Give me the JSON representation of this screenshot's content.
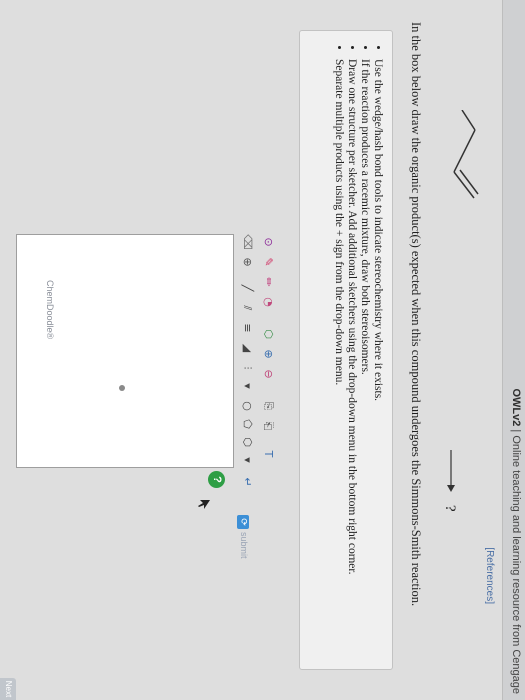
{
  "header": {
    "brand": "OWLv2",
    "brand_tagline": "| Online teaching and learning resource from Cengage"
  },
  "reference_link": "[References]",
  "question": {
    "text": "In the box below draw the organic product(s) expected when this compound undergoes the Simmons-Smith reaction.",
    "arrow": "→",
    "unknown_product": "?"
  },
  "instructions": [
    "Use the wedge/hash bond tools to indicate stereochemistry where it exists.",
    "If the reaction produces a racemic mixture, draw both stereoisomers.",
    "Draw one structure per sketcher. Add additional sketchers using the drop-down menu in the bottom right corner.",
    "Separate multiple products using the + sign from the drop-down menu."
  ],
  "toolbar": {
    "row1": [
      {
        "name": "lasso-tool-icon",
        "glyph": "⊙"
      },
      {
        "name": "eraser-tool-icon",
        "glyph": "✎"
      },
      {
        "name": "pencil-tool-icon",
        "glyph": "✏"
      },
      {
        "name": "ring-tool-icon",
        "glyph": "◔"
      },
      {
        "name": "template-tool-icon",
        "glyph": "⬡"
      },
      {
        "name": "charge-plus-icon",
        "glyph": "⊕"
      },
      {
        "name": "charge-minus-icon",
        "glyph": "⊖"
      },
      {
        "name": "copy-tool-icon",
        "glyph": "⎘"
      },
      {
        "name": "paste-tool-icon",
        "glyph": "⎗"
      },
      {
        "name": "text-tool-icon",
        "glyph": "T"
      }
    ],
    "row2": [
      {
        "name": "clear-canvas-icon",
        "glyph": "⌫"
      },
      {
        "name": "atom-dropdown-icon",
        "glyph": "⊕"
      },
      {
        "name": "single-bond-icon",
        "glyph": "╱"
      },
      {
        "name": "double-bond-icon",
        "glyph": "⫽"
      },
      {
        "name": "triple-bond-icon",
        "glyph": "≡"
      },
      {
        "name": "wedge-bond-icon",
        "glyph": "◢"
      },
      {
        "name": "hash-bond-icon",
        "glyph": "⫶"
      },
      {
        "name": "bond-dropdown-icon",
        "glyph": "▾"
      },
      {
        "name": "ring3-icon",
        "glyph": "○"
      },
      {
        "name": "ring5-icon",
        "glyph": "⬠"
      },
      {
        "name": "ring6-icon",
        "glyph": "⬡"
      },
      {
        "name": "ring-dropdown-icon",
        "glyph": "▾"
      },
      {
        "name": "more-tools-icon",
        "glyph": "↵"
      }
    ]
  },
  "sketcher": {
    "watermark": "ChemDoodle®",
    "help_label": "?"
  },
  "submit": {
    "icon": "⟳",
    "label": "submit"
  },
  "corner_button": "Next"
}
